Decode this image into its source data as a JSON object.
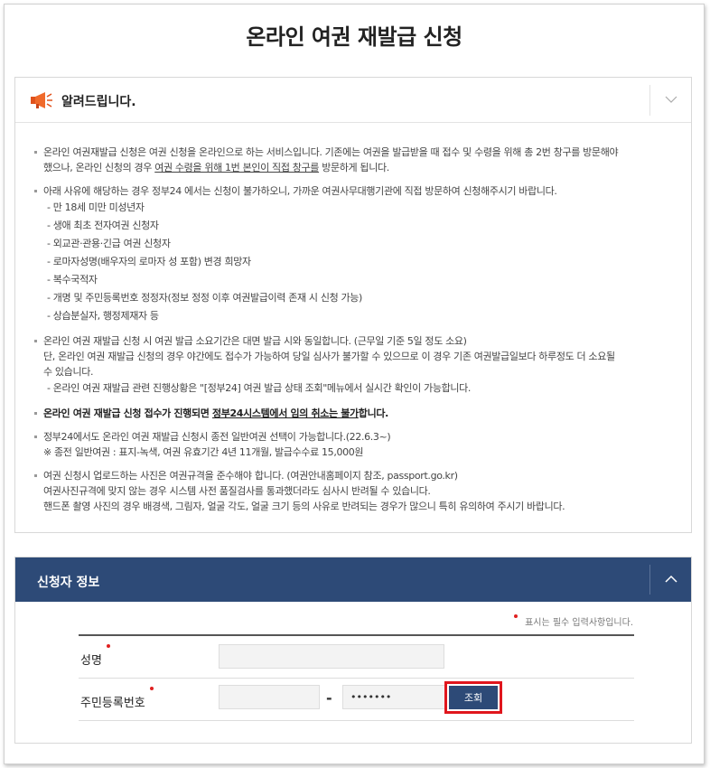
{
  "page": {
    "title": "온라인 여권 재발급 신청"
  },
  "notice": {
    "title": "알려드립니다.",
    "items": [
      {
        "line1_pre": "온라인 여권재발급 신청은 여권 신청을 온라인으로 하는 서비스입니다. 기존에는 여권을 발급받을 때 접수 및 수령을 위해 총 2번 창구를 방문해야",
        "line2_pre": "했으나, 온라인 신청의 경우 ",
        "line2_u": "여권 수령을 위해 1번 본인이 직접 창구를",
        "line2_post": " 방문하게 됩니다."
      },
      {
        "line1": "아래 사유에 해당하는 경우 정부24 에서는 신청이 불가하오니, 가까운 여권사무대행기관에 직접 방문하여 신청해주시기 바랍니다.",
        "subs": [
          "- 만 18세 미만 미성년자",
          "- 생애 최초 전자여권 신청자",
          "- 외교관·관용·긴급 여권 신청자",
          "- 로마자성명(배우자의 로마자 성 포함) 변경 희망자",
          "- 복수국적자",
          "- 개명 및 주민등록번호 정정자(정보 정정 이후 여권발급이력 존재 시 신청 가능)",
          "- 상습분실자, 행정제재자 등"
        ]
      },
      {
        "line1": "온라인 여권 재발급 신청 시 여권 발급 소요기간은 대면 발급 시와 동일합니다. (근무일 기준 5일 정도 소요)",
        "line2": "단, 온라인 여권 재발급 신청의 경우 야간에도 접수가 가능하여 당일 심사가 불가할 수 있으므로 이 경우 기존 여권발급일보다 하루정도 더 소요될",
        "line3": "수 있습니다.",
        "sub": "- 온라인 여권 재발급 관련 진행상황은 \"[정부24] 여권 발급 상태 조회\"메뉴에서 실시간 확인이 가능합니다."
      },
      {
        "bold_pre": "온라인 여권 재발급 신청 접수가 진행되면 ",
        "bold_u": "정부24시스템에서 임의 취소는 불가",
        "bold_post": "합니다."
      },
      {
        "line1": "정부24에서도 온라인 여권 재발급 신청시 종전 일반여권 선택이 가능합니다.(22.6.3~)",
        "line2": "※ 종전 일반여권 : 표지-녹색, 여권 유효기간 4년 11개월, 발급수수료 15,000원"
      },
      {
        "line1": "여권 신청시 업로드하는 사진은 여권규격을 준수해야 합니다. (여권안내홈페이지 참조, passport.go.kr)",
        "line2": "여권사진규격에 맞지 않는 경우 시스템 사전 품질검사를 통과했더라도 심사시 반려될 수 있습니다.",
        "line3": "핸드폰 촬영 사진의 경우 배경색, 그림자, 얼굴 각도, 얼굴 크기 등의 사유로 반려되는 경우가 많으니 특히 유의하여 주시기 바랍니다."
      }
    ]
  },
  "applicant": {
    "title": "신청자 정보",
    "required_note": "표시는 필수 입력사항입니다.",
    "name_label": "성명",
    "name_value": "",
    "rrn_label": "주민등록번호",
    "rrn_front_value": "",
    "rrn_dash": "-",
    "rrn_back_value": "•••••••",
    "lookup_label": "조회"
  },
  "colors": {
    "header_bg": "#2d4a77",
    "highlight_border": "#e0161d",
    "required_dot": "#e02020"
  },
  "icons": {
    "notice_icon": "megaphone-icon",
    "notice_toggle": "chevron-down-icon",
    "applicant_toggle": "chevron-up-icon"
  }
}
